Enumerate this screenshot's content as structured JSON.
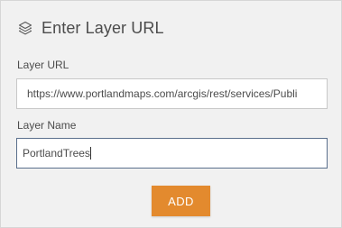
{
  "dialog": {
    "title": "Enter Layer URL",
    "icon": "layers-icon"
  },
  "form": {
    "url_label": "Layer URL",
    "url_value": "https://www.portlandmaps.com/arcgis/rest/services/Publi",
    "name_label": "Layer Name",
    "name_value": "PortlandTrees"
  },
  "actions": {
    "add_label": "ADD"
  },
  "colors": {
    "panel_background": "#f1f1f1",
    "add_button": "#e38a2e",
    "focused_border": "#5a6f8c"
  }
}
